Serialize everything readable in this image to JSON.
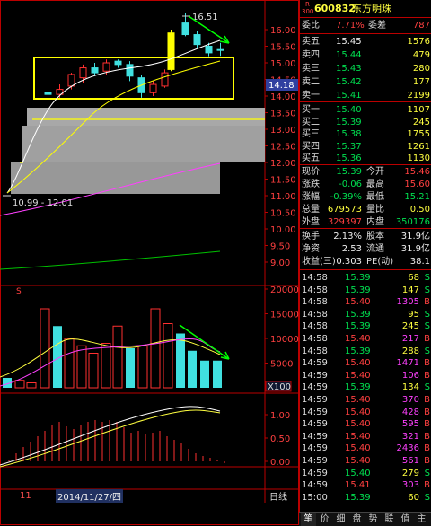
{
  "stock": {
    "code": "600832",
    "name": "东方明珠",
    "badge_top": "R",
    "badge_bottom": "300"
  },
  "kline": {
    "price_axis": [
      "16.00",
      "15.50",
      "15.00",
      "14.50",
      "14.00",
      "13.50",
      "13.00",
      "12.50",
      "12.00",
      "11.50",
      "11.00",
      "10.50",
      "10.00",
      "9.50",
      "9.00"
    ],
    "current_price_tag": "14.18",
    "high_label": "16.51",
    "range_label": "10.99 - 12.01"
  },
  "volume": {
    "axis": [
      "20000",
      "15000",
      "10000",
      "5000"
    ],
    "unit_label": "X100"
  },
  "macd": {
    "axis": [
      "1.00",
      "0.50",
      "0.00"
    ]
  },
  "bottom": {
    "day_label": "11",
    "date_label": "2014/11/27/四",
    "period_label": "日线"
  },
  "quote": {
    "wei_bi_label": "委比",
    "wei_bi": "7.71%",
    "wei_cha_label": "委差",
    "wei_cha": "787",
    "asks": [
      {
        "label": "卖五",
        "price": "15.45",
        "vol": "1576"
      },
      {
        "label": "卖四",
        "price": "15.44",
        "vol": "479"
      },
      {
        "label": "卖三",
        "price": "15.43",
        "vol": "280"
      },
      {
        "label": "卖二",
        "price": "15.42",
        "vol": "177"
      },
      {
        "label": "卖一",
        "price": "15.41",
        "vol": "2199"
      }
    ],
    "bids": [
      {
        "label": "买一",
        "price": "15.40",
        "vol": "1107"
      },
      {
        "label": "买二",
        "price": "15.39",
        "vol": "245"
      },
      {
        "label": "买三",
        "price": "15.38",
        "vol": "1755"
      },
      {
        "label": "买四",
        "price": "15.37",
        "vol": "1261"
      },
      {
        "label": "买五",
        "price": "15.36",
        "vol": "1130"
      }
    ],
    "stats": [
      {
        "l1": "现价",
        "v1": "15.39",
        "l2": "今开",
        "v2": "15.46"
      },
      {
        "l1": "涨跌",
        "v1": "-0.06",
        "l2": "最高",
        "v2": "15.60"
      },
      {
        "l1": "涨幅",
        "v1": "-0.39%",
        "l2": "最低",
        "v2": "15.21"
      },
      {
        "l1": "总量",
        "v1": "679573",
        "l2": "量比",
        "v2": "0.50"
      },
      {
        "l1": "外盘",
        "v1": "329397",
        "l2": "内盘",
        "v2": "350176"
      }
    ],
    "stats2": [
      {
        "l1": "换手",
        "v1": "2.13%",
        "l2": "股本",
        "v2": "31.9亿"
      },
      {
        "l1": "净资",
        "v1": "2.53",
        "l2": "流通",
        "v2": "31.9亿"
      },
      {
        "l1": "收益(三)",
        "v1": "0.303",
        "l2": "PE(动)",
        "v2": "38.1"
      }
    ]
  },
  "ticks": [
    {
      "t": "14:58",
      "p": "15.39",
      "v": "68",
      "d": "S"
    },
    {
      "t": "14:58",
      "p": "15.39",
      "v": "147",
      "d": "S"
    },
    {
      "t": "14:58",
      "p": "15.40",
      "v": "1305",
      "d": "B"
    },
    {
      "t": "14:58",
      "p": "15.39",
      "v": "95",
      "d": "S"
    },
    {
      "t": "14:58",
      "p": "15.39",
      "v": "245",
      "d": "S"
    },
    {
      "t": "14:58",
      "p": "15.40",
      "v": "217",
      "d": "B"
    },
    {
      "t": "14:58",
      "p": "15.39",
      "v": "288",
      "d": "S"
    },
    {
      "t": "14:59",
      "p": "15.40",
      "v": "1471",
      "d": "B"
    },
    {
      "t": "14:59",
      "p": "15.40",
      "v": "106",
      "d": "B"
    },
    {
      "t": "14:59",
      "p": "15.39",
      "v": "134",
      "d": "S"
    },
    {
      "t": "14:59",
      "p": "15.40",
      "v": "370",
      "d": "B"
    },
    {
      "t": "14:59",
      "p": "15.40",
      "v": "428",
      "d": "B"
    },
    {
      "t": "14:59",
      "p": "15.40",
      "v": "595",
      "d": "B"
    },
    {
      "t": "14:59",
      "p": "15.40",
      "v": "321",
      "d": "B"
    },
    {
      "t": "14:59",
      "p": "15.40",
      "v": "2436",
      "d": "B"
    },
    {
      "t": "14:59",
      "p": "15.40",
      "v": "561",
      "d": "B"
    },
    {
      "t": "14:59",
      "p": "15.40",
      "v": "279",
      "d": "S"
    },
    {
      "t": "14:59",
      "p": "15.41",
      "v": "303",
      "d": "B"
    },
    {
      "t": "15:00",
      "p": "15.39",
      "v": "60",
      "d": "S"
    }
  ],
  "tabs": [
    "笔",
    "价",
    "细",
    "盘",
    "势",
    "联",
    "值",
    "主"
  ],
  "colors": {
    "up": "#ff3030",
    "down": "#40e0e0",
    "highlight_box": "#ffff00",
    "arrow": "#00ff00",
    "ma5": "#ffffff",
    "ma10": "#ffff00",
    "ma20": "#ff40ff",
    "ma60": "#00c000"
  }
}
